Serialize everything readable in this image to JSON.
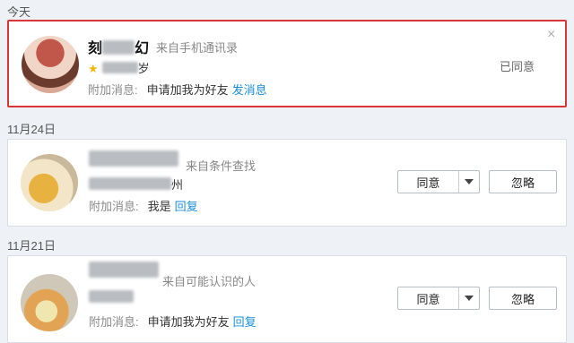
{
  "sections": [
    {
      "date": "今天",
      "items": [
        {
          "name_visible_a": "刻",
          "name_visible_b": "幻",
          "source": "来自手机通讯录",
          "age_suffix": "岁",
          "extra_label": "附加消息:",
          "extra_text": "申请加我为好友",
          "extra_link": "发消息",
          "status": "已同意",
          "close": "×"
        }
      ]
    },
    {
      "date": "11月24日",
      "items": [
        {
          "source": "来自条件查找",
          "location_suffix": "州",
          "extra_label": "附加消息:",
          "extra_text": "我是",
          "extra_link": "回复",
          "accept": "同意",
          "ignore": "忽略"
        }
      ]
    },
    {
      "date": "11月21日",
      "items": [
        {
          "source": "来自可能认识的人",
          "extra_label": "附加消息:",
          "extra_text": "申请加我为好友",
          "extra_link": "回复",
          "accept": "同意",
          "ignore": "忽略"
        }
      ]
    }
  ],
  "colors": {
    "highlight_border": "#d9363a",
    "link": "#1a8fd8"
  }
}
